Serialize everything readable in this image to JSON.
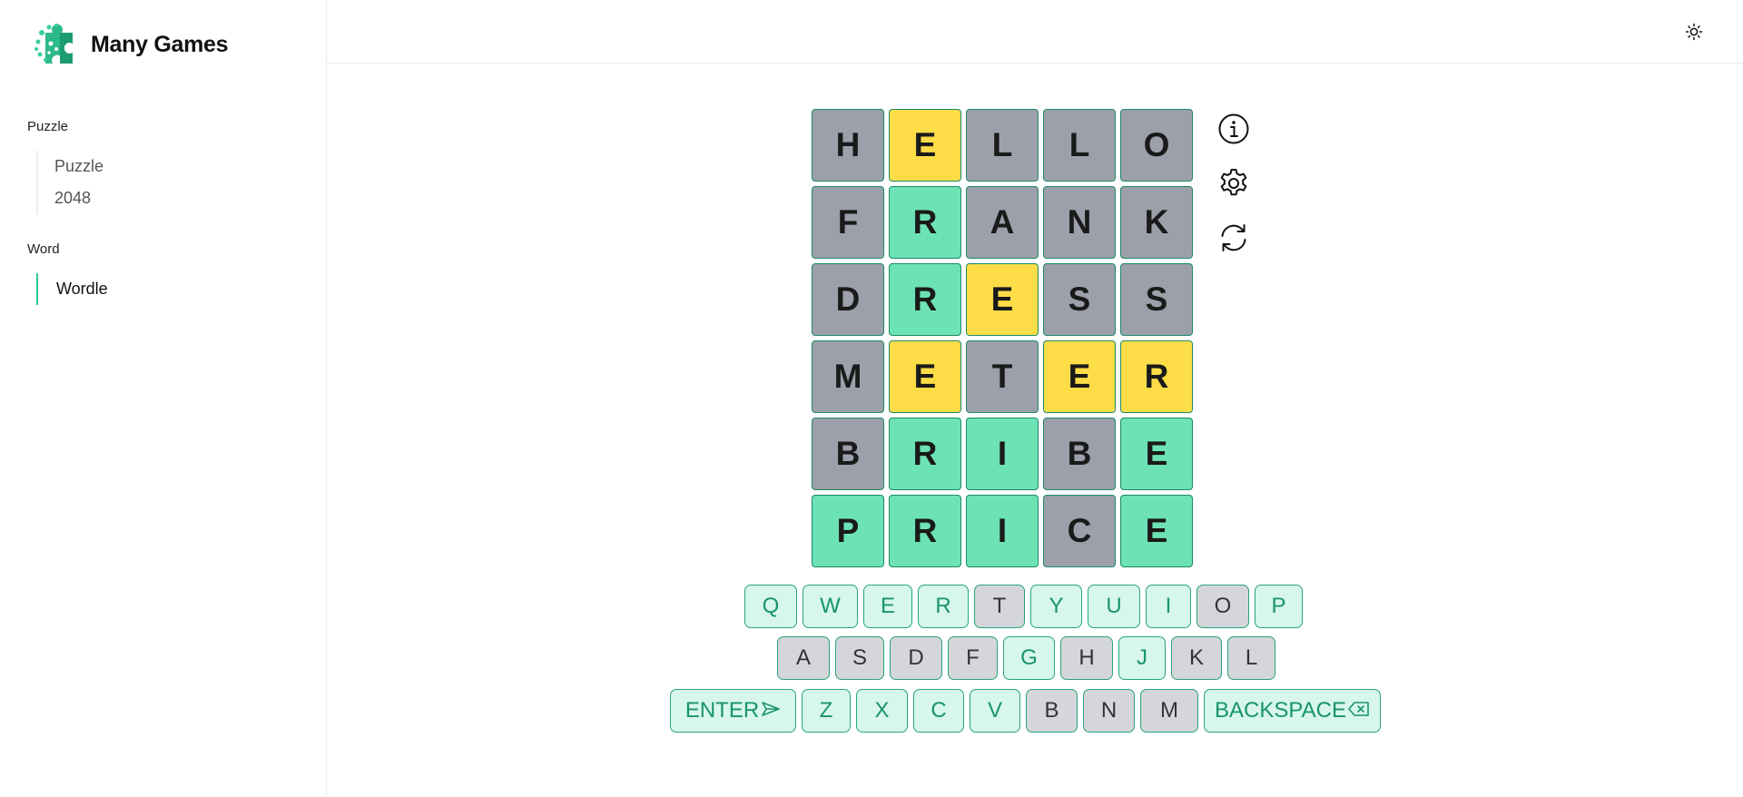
{
  "brand": {
    "title": "Many Games",
    "logo_icon": "puzzle-piece-icon"
  },
  "sidebar": {
    "groups": [
      {
        "title": "Puzzle",
        "items": [
          {
            "label": "Puzzle"
          },
          {
            "label": "2048"
          }
        ]
      },
      {
        "title": "Word",
        "items": [
          {
            "label": "Wordle",
            "active": true
          }
        ]
      }
    ]
  },
  "header": {
    "theme_icon": "sun-icon"
  },
  "colors": {
    "absent": "#9ca0aa",
    "present": "#fcdd48",
    "correct": "#6de2b4",
    "accent": "#2cc98f"
  },
  "board": {
    "rows": [
      [
        {
          "letter": "H",
          "state": "absent"
        },
        {
          "letter": "E",
          "state": "present"
        },
        {
          "letter": "L",
          "state": "absent"
        },
        {
          "letter": "L",
          "state": "absent"
        },
        {
          "letter": "O",
          "state": "absent"
        }
      ],
      [
        {
          "letter": "F",
          "state": "absent"
        },
        {
          "letter": "R",
          "state": "correct"
        },
        {
          "letter": "A",
          "state": "absent"
        },
        {
          "letter": "N",
          "state": "absent"
        },
        {
          "letter": "K",
          "state": "absent"
        }
      ],
      [
        {
          "letter": "D",
          "state": "absent"
        },
        {
          "letter": "R",
          "state": "correct"
        },
        {
          "letter": "E",
          "state": "present"
        },
        {
          "letter": "S",
          "state": "absent"
        },
        {
          "letter": "S",
          "state": "absent"
        }
      ],
      [
        {
          "letter": "M",
          "state": "absent"
        },
        {
          "letter": "E",
          "state": "present"
        },
        {
          "letter": "T",
          "state": "absent"
        },
        {
          "letter": "E",
          "state": "present"
        },
        {
          "letter": "R",
          "state": "present"
        }
      ],
      [
        {
          "letter": "B",
          "state": "absent"
        },
        {
          "letter": "R",
          "state": "correct"
        },
        {
          "letter": "I",
          "state": "correct"
        },
        {
          "letter": "B",
          "state": "absent"
        },
        {
          "letter": "E",
          "state": "correct"
        }
      ],
      [
        {
          "letter": "P",
          "state": "correct"
        },
        {
          "letter": "R",
          "state": "correct"
        },
        {
          "letter": "I",
          "state": "correct"
        },
        {
          "letter": "C",
          "state": "absent"
        },
        {
          "letter": "E",
          "state": "correct"
        }
      ]
    ]
  },
  "tools": [
    {
      "icon": "info-icon"
    },
    {
      "icon": "gear-icon"
    },
    {
      "icon": "refresh-icon"
    }
  ],
  "keyboard": {
    "rows": [
      [
        {
          "k": "Q"
        },
        {
          "k": "W"
        },
        {
          "k": "E"
        },
        {
          "k": "R"
        },
        {
          "k": "T",
          "used": true
        },
        {
          "k": "Y"
        },
        {
          "k": "U"
        },
        {
          "k": "I"
        },
        {
          "k": "O",
          "used": true
        },
        {
          "k": "P"
        }
      ],
      [
        {
          "k": "A",
          "used": true
        },
        {
          "k": "S",
          "used": true
        },
        {
          "k": "D",
          "used": true
        },
        {
          "k": "F",
          "used": true
        },
        {
          "k": "G"
        },
        {
          "k": "H",
          "used": true
        },
        {
          "k": "J"
        },
        {
          "k": "K",
          "used": true
        },
        {
          "k": "L",
          "used": true
        }
      ],
      [
        {
          "k": "ENTER",
          "icon": "send-icon"
        },
        {
          "k": "Z"
        },
        {
          "k": "X"
        },
        {
          "k": "C"
        },
        {
          "k": "V"
        },
        {
          "k": "B",
          "used": true
        },
        {
          "k": "N",
          "used": true
        },
        {
          "k": "M",
          "used": true
        },
        {
          "k": "BACKSPACE",
          "icon": "backspace-icon"
        }
      ]
    ]
  }
}
